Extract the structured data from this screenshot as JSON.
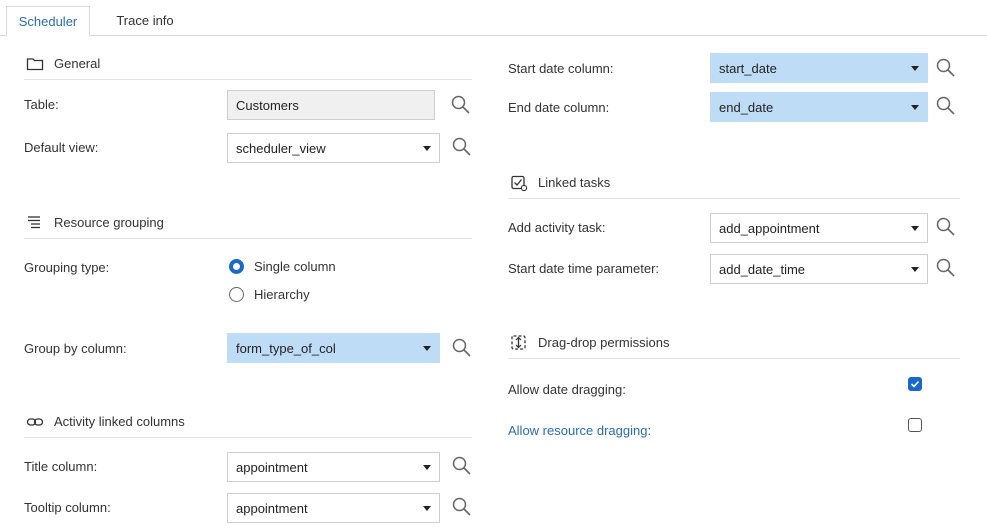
{
  "tabs": [
    {
      "label": "Scheduler",
      "active": true
    },
    {
      "label": "Trace info",
      "active": false
    }
  ],
  "general": {
    "title": "General",
    "icon": "folder-icon",
    "table_label": "Table:",
    "table_value": "Customers",
    "default_view_label": "Default view:",
    "default_view_value": "scheduler_view"
  },
  "resource_grouping": {
    "title": "Resource grouping",
    "icon": "list-icon",
    "grouping_type_label": "Grouping type:",
    "options": [
      {
        "label": "Single column",
        "selected": true
      },
      {
        "label": "Hierarchy",
        "selected": false
      }
    ],
    "group_by_label": "Group by column:",
    "group_by_value": "form_type_of_col"
  },
  "activity_linked_columns": {
    "title": "Activity linked columns",
    "icon": "link-icon",
    "title_column_label": "Title column:",
    "title_column_value": "appointment",
    "tooltip_column_label": "Tooltip column:",
    "tooltip_column_value": "appointment"
  },
  "dates": {
    "start_label": "Start date column:",
    "start_value": "start_date",
    "end_label": "End date column:",
    "end_value": "end_date"
  },
  "linked_tasks": {
    "title": "Linked tasks",
    "icon": "task-icon",
    "add_activity_label": "Add activity task:",
    "add_activity_value": "add_appointment",
    "start_param_label": "Start date time parameter:",
    "start_param_value": "add_date_time"
  },
  "drag_drop": {
    "title": "Drag-drop permissions",
    "icon": "drag-drop-icon",
    "allow_date_label": "Allow date dragging:",
    "allow_date_checked": true,
    "allow_resource_label": "Allow resource dragging:",
    "allow_resource_checked": false
  },
  "colors": {
    "accent": "#1a68c8",
    "highlight_field": "#bfdcf7",
    "link_text": "#2b6cb0"
  }
}
